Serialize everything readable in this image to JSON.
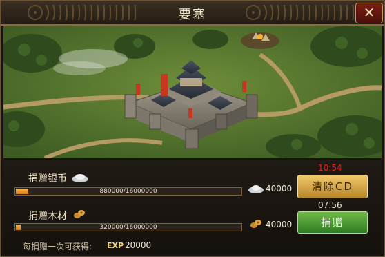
{
  "window": {
    "title": "要塞",
    "close_glyph": "✕"
  },
  "donate_silver": {
    "label": "捐赠银币",
    "progress_text": "880000/16000000",
    "progress_fraction": 0.055,
    "cost": "40000",
    "icon": "silver-ingot-icon"
  },
  "donate_wood": {
    "label": "捐赠木材",
    "progress_text": "320000/16000000",
    "progress_fraction": 0.02,
    "cost": "40000",
    "icon": "wood-log-icon"
  },
  "cooldown": {
    "timer": "10:54",
    "timer_color": "#e5241b"
  },
  "clear_cd_button": {
    "label": "清除CD"
  },
  "donate_timer": {
    "timer": "07:56"
  },
  "donate_button": {
    "label": "捐赠"
  },
  "reward": {
    "prefix": "每捐赠一次可获得:",
    "exp_tag": "EXP",
    "exp_value": "20000"
  },
  "colors": {
    "accent_gold": "#c29a56",
    "progress_orange": "#e8921f",
    "button_yellow": "#e2b552",
    "button_green": "#4a9b33"
  }
}
